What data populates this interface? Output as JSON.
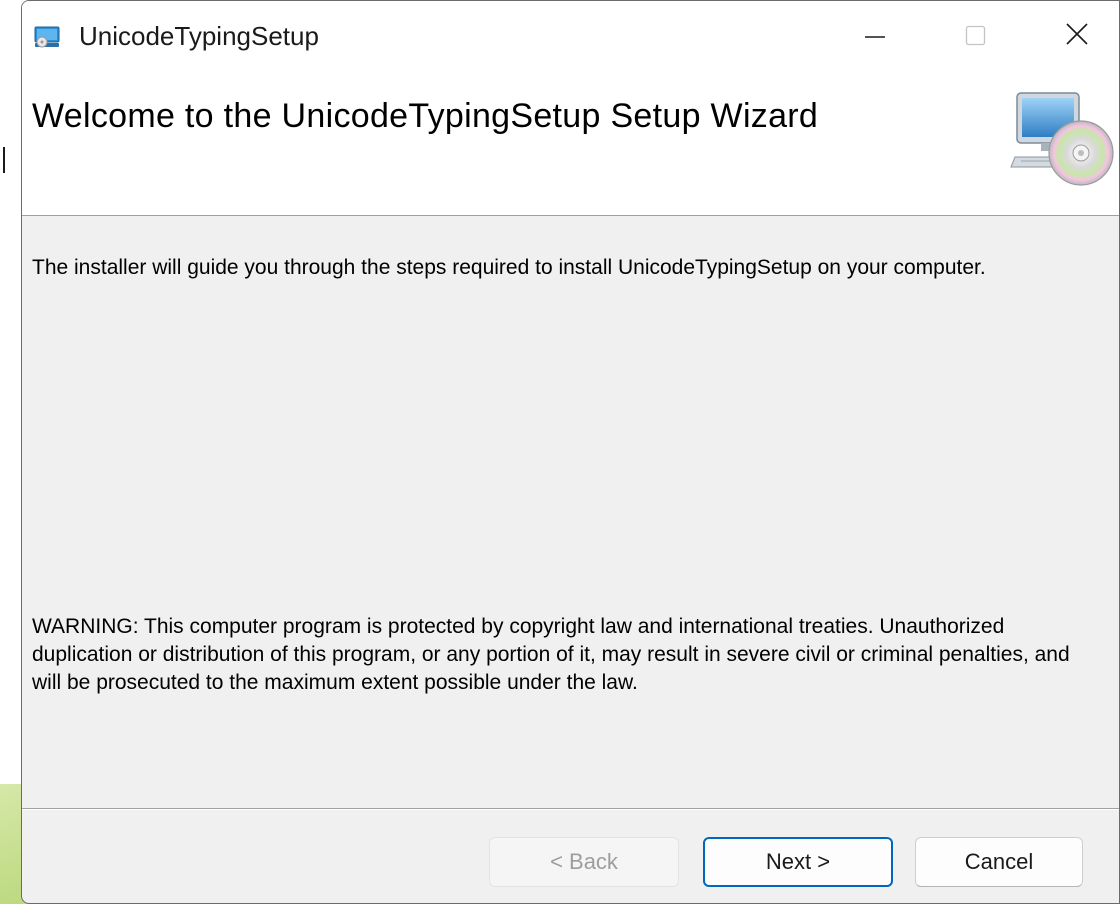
{
  "window": {
    "title": "UnicodeTypingSetup"
  },
  "header": {
    "title": "Welcome to the UnicodeTypingSetup Setup Wizard",
    "graphic": "computer-cd-icon"
  },
  "content": {
    "intro": "The installer will guide you through the steps required to install UnicodeTypingSetup on your computer.",
    "warning": "WARNING: This computer program is protected by copyright law and international treaties. Unauthorized duplication or distribution of this program, or any portion of it, may result in severe civil or criminal penalties, and will be prosecuted to the maximum extent possible under the law."
  },
  "buttons": {
    "back": "< Back",
    "next": "Next >",
    "cancel": "Cancel",
    "back_enabled": false,
    "default_button": "next"
  },
  "colors": {
    "accent": "#0067c0",
    "dialog_bg": "#f0f0f0",
    "header_bg": "#ffffff"
  }
}
